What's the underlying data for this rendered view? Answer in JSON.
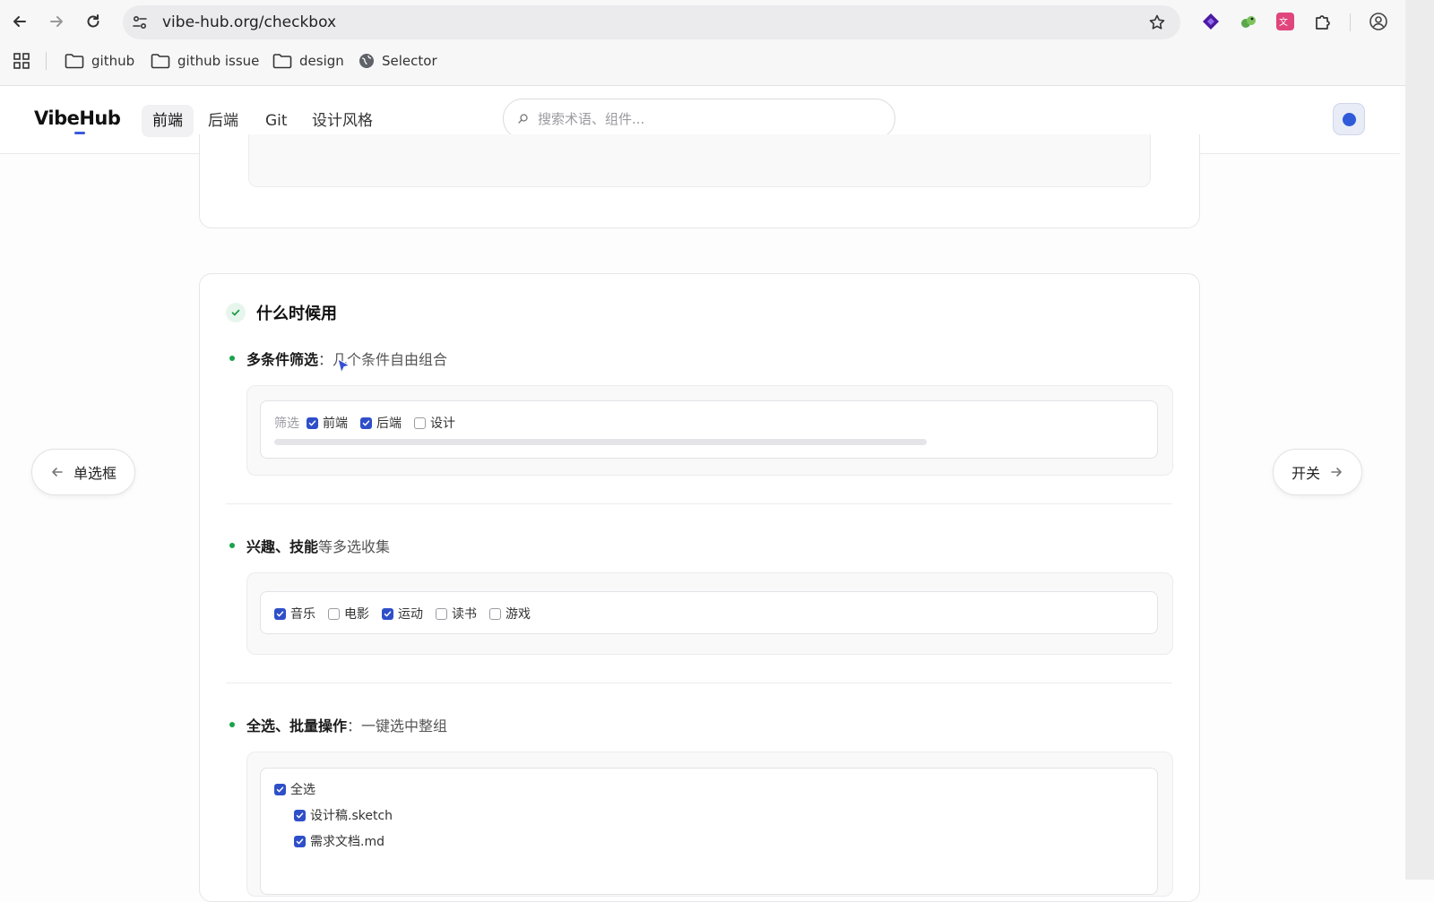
{
  "browser": {
    "url": "vibe-hub.org/checkbox",
    "bookmarks": [
      {
        "label": "github",
        "icon": "folder-icon"
      },
      {
        "label": "github issue",
        "icon": "folder-icon"
      },
      {
        "label": "design",
        "icon": "folder-icon"
      },
      {
        "label": "Selector",
        "icon": "globe-icon"
      }
    ]
  },
  "site": {
    "logo": "VibeHub",
    "nav": [
      "前端",
      "后端",
      "Git",
      "设计风格"
    ],
    "active_nav": "前端",
    "search_placeholder": "搜索术语、组件..."
  },
  "section": {
    "title": "什么时候用",
    "items": [
      {
        "bold": "多条件筛选",
        "rest": "：几个条件自由组合"
      },
      {
        "bold": "兴趣、技能",
        "rest": "等多选收集"
      },
      {
        "bold": "全选、批量操作",
        "rest": "：一键选中整组"
      }
    ]
  },
  "demo_filter": {
    "label": "筛选",
    "options": [
      {
        "label": "前端",
        "checked": true
      },
      {
        "label": "后端",
        "checked": true
      },
      {
        "label": "设计",
        "checked": false
      }
    ]
  },
  "demo_interests": {
    "options": [
      {
        "label": "音乐",
        "checked": true
      },
      {
        "label": "电影",
        "checked": false
      },
      {
        "label": "运动",
        "checked": true
      },
      {
        "label": "读书",
        "checked": false
      },
      {
        "label": "游戏",
        "checked": false
      }
    ]
  },
  "demo_select_all": {
    "all_label": "全选",
    "all_checked": true,
    "children": [
      {
        "label": "设计稿.sketch",
        "checked": true
      },
      {
        "label": "需求文档.md",
        "checked": true
      }
    ]
  },
  "pager": {
    "prev": "单选框",
    "next": "开关"
  },
  "colors": {
    "accent": "#2f4fc9",
    "bullet": "#1aa34a"
  }
}
